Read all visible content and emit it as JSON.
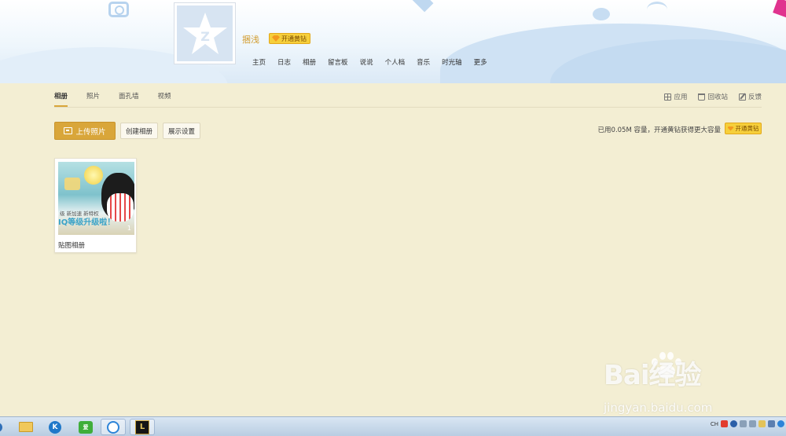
{
  "profile": {
    "name": "捆浅",
    "vip_label": "开通黄钻"
  },
  "nav": [
    "主页",
    "日志",
    "相册",
    "留言板",
    "说说",
    "个人档",
    "音乐",
    "时光轴",
    "更多"
  ],
  "tabs": [
    "相册",
    "照片",
    "面孔墙",
    "视频"
  ],
  "active_tab": "相册",
  "tools": [
    "应用",
    "回收站",
    "反馈"
  ],
  "actions": {
    "upload": "上传照片",
    "create": "创建相册",
    "display": "展示设置"
  },
  "storage_text": "已用0.05M 容量，开通黄钻获得更大容量",
  "storage_vip": "开通黄钻",
  "albums": [
    {
      "name": "贴图相册",
      "count": "1",
      "cover_small": "级 新加速 新特权",
      "cover_big": "IQ等级升级啦！"
    }
  ],
  "watermark": {
    "main": "Bai经验",
    "du": "du",
    "sub": "jingyan.baidu.com"
  },
  "taskbar": {
    "tray_lang": "CH"
  },
  "colors": {
    "accent": "#d9a63a",
    "vip": "#f6cf3b",
    "panel": "#f3eed3"
  }
}
